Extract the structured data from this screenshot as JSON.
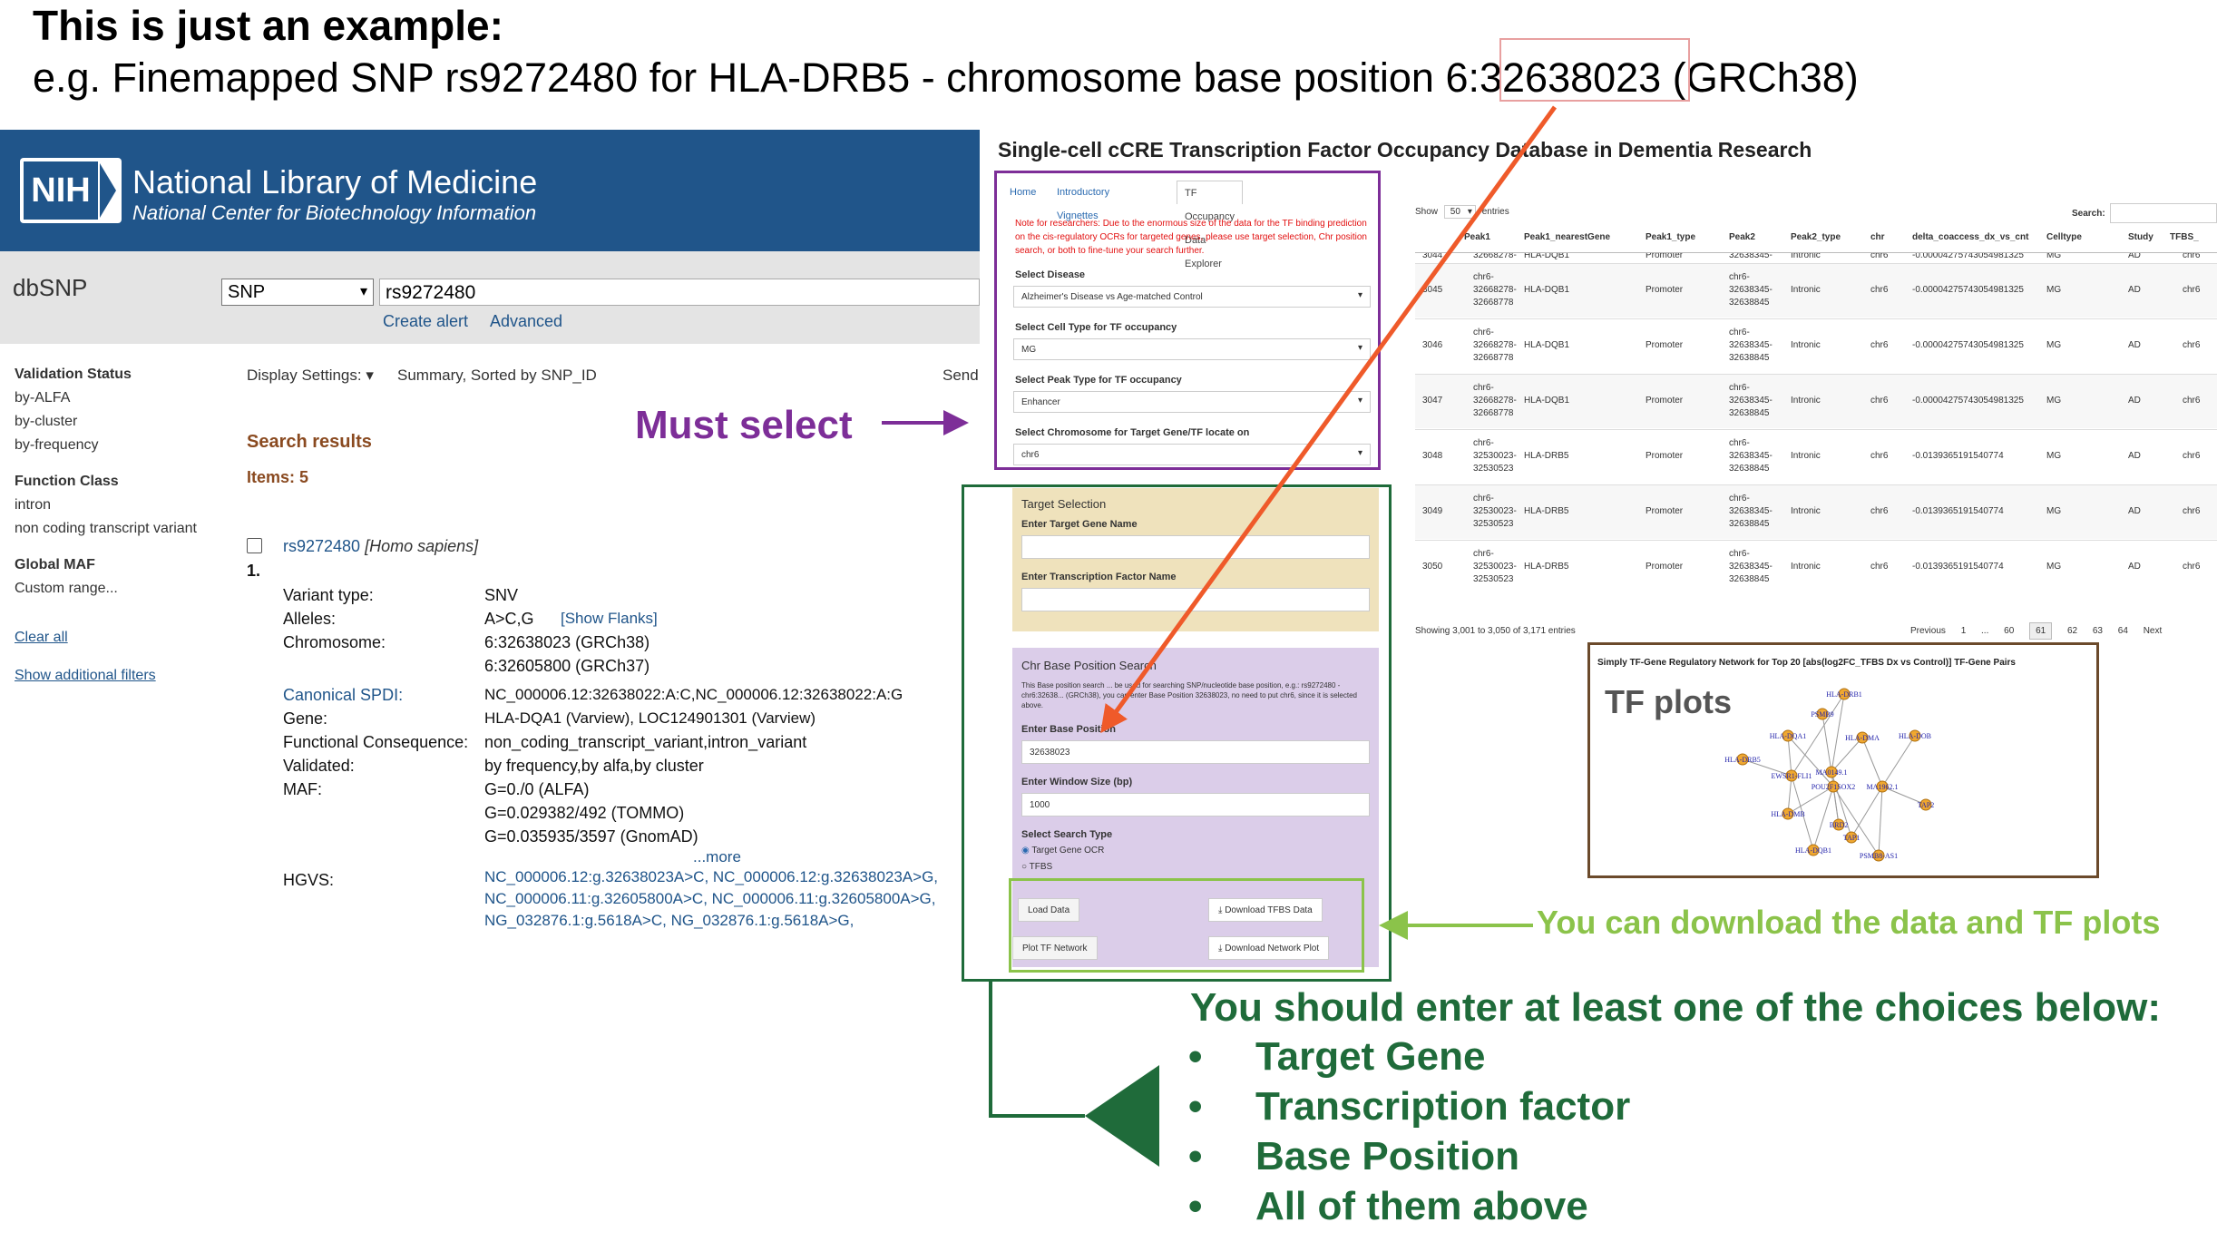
{
  "header": {
    "title": "This is just an example:",
    "subtitle": "e.g. Finemapped SNP rs9272480 for HLA-DRB5  - chromosome base position 6:32638023 (GRCh38)"
  },
  "nih": {
    "logo_text": "NIH",
    "name": "National Library of Medicine",
    "center": "National Center for Biotechnology Information",
    "db_label": "dbSNP",
    "search_type": "SNP",
    "search_value": "rs9272480",
    "create_alert": "Create alert",
    "advanced": "Advanced",
    "sidebar": {
      "validation_status": "Validation Status",
      "validation_items": [
        "by-ALFA",
        "by-cluster",
        "by-frequency"
      ],
      "function_class": "Function Class",
      "function_items": [
        "intron",
        "non coding transcript variant"
      ],
      "global_maf": "Global MAF",
      "global_maf_item": "Custom range...",
      "clear_all": "Clear all",
      "show_filters": "Show additional filters"
    },
    "display_settings": "Display Settings:",
    "summary": "Summary, Sorted by SNP_ID",
    "send": "Send",
    "search_results": "Search results",
    "items": "Items: 5",
    "result": {
      "rs_id": "rs9272480",
      "species": "[Homo sapiens]",
      "index": "1.",
      "fields": [
        {
          "k": "Variant type:",
          "v": "SNV"
        },
        {
          "k": "Alleles:",
          "v": "A>C,G"
        },
        {
          "k": "Chromosome:",
          "v": "6:32638023 (GRCh38)"
        },
        {
          "k": "",
          "v": "6:32605800 (GRCh37)"
        },
        {
          "k": "Canonical SPDI:",
          "v": "NC_000006.12:32638022:A:C,NC_000006.12:32638022:A:G"
        },
        {
          "k": "Gene:",
          "v": "HLA-DQA1 (Varview), LOC124901301 (Varview)"
        },
        {
          "k": "Functional Consequence:",
          "v": "non_coding_transcript_variant,intron_variant"
        },
        {
          "k": "Validated:",
          "v": "by frequency,by alfa,by cluster"
        },
        {
          "k": "MAF:",
          "v": "G=0./0 (ALFA)"
        },
        {
          "k": "",
          "v": "G=0.029382/492 (TOMMO)"
        },
        {
          "k": "",
          "v": "G=0.035935/3597 (GnomAD)"
        }
      ],
      "show_flanks": "[Show Flanks]",
      "more": "...more",
      "hgvs_label": "HGVS:",
      "hgvs": [
        "NC_000006.12:g.32638023A>C, NC_000006.12:g.32638023A>G,",
        "NC_000006.11:g.32605800A>C, NC_000006.11:g.32605800A>G,",
        "NG_032876.1:g.5618A>C, NG_032876.1:g.5618A>G,"
      ]
    }
  },
  "app": {
    "title": "Single-cell cCRE Transcription Factor Occupancy Database in Dementia Research",
    "tabs": [
      "Home",
      "Introductory Vignettes",
      "TF Occupancy Data Explorer"
    ],
    "note": "Note for researchers: Due to the enormous size of the data for the TF binding prediction on the cis-regulatory OCRs for targeted genes, please use target selection, Chr position search, or both to fine-tune your search further.",
    "select_disease_label": "Select Disease",
    "select_disease_value": "Alzheimer's Disease vs Age-matched Control",
    "select_cell_label": "Select Cell Type for TF occupancy",
    "select_cell_value": "MG",
    "select_peak_label": "Select Peak Type for TF occupancy",
    "select_peak_value": "Enhancer",
    "select_chr_label": "Select Chromosome for Target Gene/TF locate on",
    "select_chr_value": "chr6",
    "target_selection": "Target Selection",
    "target_gene_label": "Enter Target Gene Name",
    "tf_label": "Enter Transcription Factor Name",
    "chr_search": "Chr Base Position Search",
    "chr_note": "This Base position search ... be used for searching SNP/nucleotide base position, e.g.: rs9272480 - chr6:32638... (GRCh38), you can enter Base Position 32638023, no need to put chr6, since it is selected above.",
    "base_pos_label": "Enter Base Position",
    "base_pos_value": "32638023",
    "window_label": "Enter Window Size (bp)",
    "window_value": "1000",
    "search_type_label": "Select Search Type",
    "search_type_opt1": "Target Gene OCR",
    "search_type_opt2": "TFBS",
    "load_data": "Load Data",
    "download_tfbs": "Download TFBS Data",
    "plot_tf": "Plot TF Network",
    "download_plot": "Download Network Plot",
    "show": "Show",
    "show_n": "50",
    "entries": "entries",
    "search": "Search:",
    "columns": [
      "Peak1",
      "Peak1_nearestGene",
      "Peak1_type",
      "Peak2",
      "Peak2_type",
      "chr",
      "delta_coaccess_dx_vs_cnt",
      "Celltype",
      "Study",
      "TFBS_"
    ],
    "rows": [
      [
        "3045",
        "chr6-\n32668278-\n32668778",
        "HLA-DQB1",
        "Promoter",
        "chr6-\n32638345-\n32638845",
        "Intronic",
        "chr6",
        "-0.00004275743054981325",
        "MG",
        "AD",
        "chr6"
      ],
      [
        "3046",
        "chr6-\n32668278-\n32668778",
        "HLA-DQB1",
        "Promoter",
        "chr6-\n32638345-\n32638845",
        "Intronic",
        "chr6",
        "-0.00004275743054981325",
        "MG",
        "AD",
        "chr6"
      ],
      [
        "3047",
        "chr6-\n32668278-\n32668778",
        "HLA-DQB1",
        "Promoter",
        "chr6-\n32638345-\n32638845",
        "Intronic",
        "chr6",
        "-0.00004275743054981325",
        "MG",
        "AD",
        "chr6"
      ],
      [
        "3048",
        "chr6-\n32530023-\n32530523",
        "HLA-DRB5",
        "Promoter",
        "chr6-\n32638345-\n32638845",
        "Intronic",
        "chr6",
        "-0.0139365191540774",
        "MG",
        "AD",
        "chr6"
      ],
      [
        "3049",
        "chr6-\n32530023-\n32530523",
        "HLA-DRB5",
        "Promoter",
        "chr6-\n32638345-\n32638845",
        "Intronic",
        "chr6",
        "-0.0139365191540774",
        "MG",
        "AD",
        "chr6"
      ],
      [
        "3050",
        "chr6-\n32530023-\n32530523",
        "HLA-DRB5",
        "Promoter",
        "chr6-\n32638345-\n32638845",
        "Intronic",
        "chr6",
        "-0.0139365191540774",
        "MG",
        "AD",
        "chr6"
      ]
    ],
    "partial_row": [
      "3044",
      "32668278-",
      "HLA-DQB1",
      "Promoter",
      "32638345-",
      "Intronic",
      "chr6",
      "-0.00004275743054981325",
      "MG",
      "AD",
      "chr6"
    ],
    "showing": "Showing 3,001 to 3,050 of 3,171 entries",
    "pager": [
      "Previous",
      "1",
      "...",
      "60",
      "61",
      "62",
      "63",
      "64",
      "Next"
    ],
    "plot_title": "Simply TF-Gene Regulatory Network for Top 20 [abs(log2FC_TFBS Dx vs Control)] TF-Gene Pairs",
    "plot_label": "TF plots",
    "network_nodes": [
      "HLA-DRB1",
      "PSMB9",
      "HLA-DQA1",
      "HLA-DMA",
      "HLA-DOB",
      "HLA-DRB5",
      "EWSR1-FLI1",
      "MA0149.1",
      "POU2F1SOX2",
      "MA1962.1",
      "TAP2",
      "HLA-DMB",
      "BRD2",
      "TAP1",
      "HLA-DQB1",
      "PSMB8-AS1"
    ]
  },
  "annotations": {
    "must_select": "Must select",
    "download": "You can download the data and TF plots",
    "enter": "You should enter at least one of the choices below:",
    "bullet_char": "•",
    "bullets": [
      "Target Gene",
      "Transcription factor",
      "Base Position",
      "All of them above"
    ]
  },
  "colors": {
    "purple": "#7d2e98",
    "dark_green": "#1f6b3a",
    "light_green": "#8bc34a",
    "orange_arrow": "#ef5a2a",
    "nih_blue": "#20558a",
    "brown": "#6b4a2b"
  }
}
